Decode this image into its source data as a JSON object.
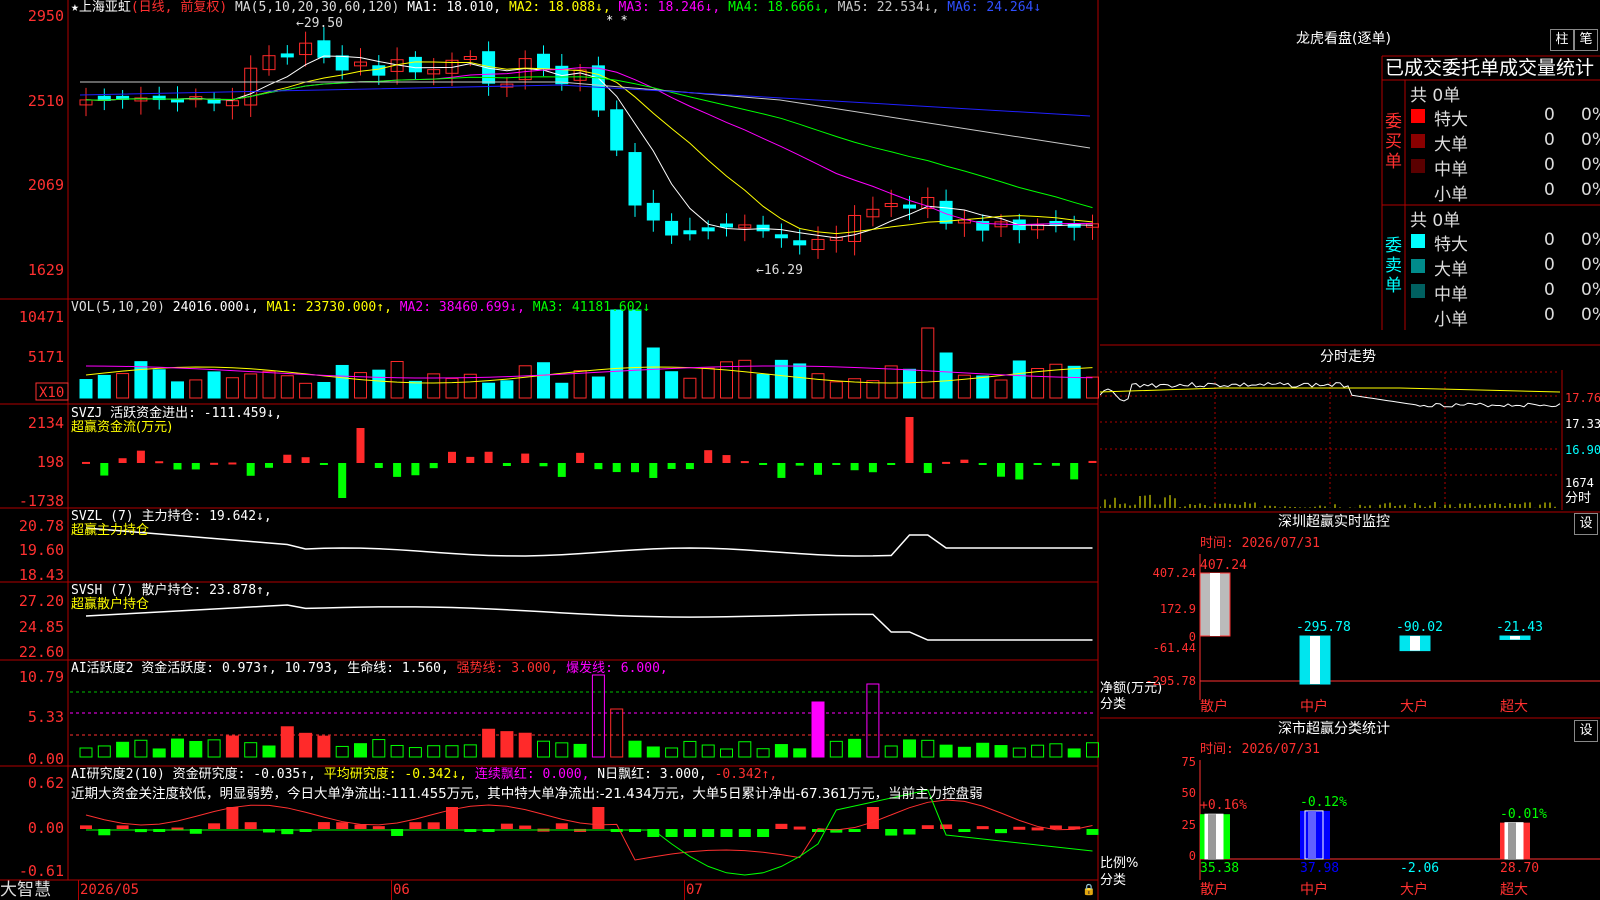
{
  "colors": {
    "up": "#ff2a2a",
    "down": "#00ffff",
    "ma1": "#ffffff",
    "ma2": "#ffff00",
    "ma3": "#ff00ff",
    "ma4": "#00ff00",
    "ma5": "#c8c8c8",
    "ma6": "#2020ff",
    "grid": "#b00000",
    "green": "#00ff00"
  },
  "kline": {
    "star": "★",
    "name": "上海亚虹",
    "period": "(日线, 前复权)",
    "ma_label": "MA(5,10,20,30,60,120)",
    "ma1": "MA1: 18.010,",
    "ma2": "MA2: 18.088↓,",
    "ma3": "MA3: 18.246↓,",
    "ma4": "MA4: 18.666↓,",
    "ma5": "MA5: 22.534↓,",
    "ma6": "MA6: 24.264↓",
    "axis": [
      "2950",
      "2510",
      "2069",
      "1629"
    ],
    "high_label": "←29.50",
    "low_label": "←16.29",
    "marks": "* *"
  },
  "vol": {
    "label": "VOL(5,10,20)",
    "v": "24016.000↓,",
    "ma1": "MA1: 23730.000↑,",
    "ma2": "MA2: 38460.699↓,",
    "ma3": "MA3: 41181.602↓",
    "axis": [
      "10471",
      "5171"
    ],
    "unit": "X10"
  },
  "svzj": {
    "label": "SVZJ  活跃资金进出: -111.459↓,",
    "sub": "超赢资金流(万元)",
    "axis": [
      "2134",
      "198",
      "-1738"
    ]
  },
  "svzl": {
    "label": "SVZL (7) 主力持仓: 19.642↓,",
    "sub": "超赢主力持仓",
    "axis": [
      "20.78",
      "19.60",
      "18.43"
    ]
  },
  "svsh": {
    "label": "SVSH (7) 散户持仓: 23.878↑,",
    "sub": "超赢散户持仓",
    "axis": [
      "27.20",
      "24.85",
      "22.60"
    ]
  },
  "ai1": {
    "a": "AI活跃度2 资金活跃度: 0.973↑,",
    "b": "10.793,",
    "c": "生命线: 1.560,",
    "d": "强势线: 3.000,",
    "e": "爆发线: 6.000,",
    "axis": [
      "10.79",
      "5.33",
      "0.00"
    ]
  },
  "ai2": {
    "a": "AI研究度2(10) 资金研究度: -0.035↑,",
    "b": "平均研究度: -0.342↓,",
    "c": "连续飘红: 0.000,",
    "d": "N日飘红: 3.000,",
    "e": "-0.342↑,",
    "desc": "近期大资金关注度较低，明显弱势，今日大单净流出:-111.455万元，其中特大单净流出:-21.434万元，大单5日累计净出-67.361万元，当前主力控盘弱",
    "axis": [
      "0.62",
      "0.00",
      "-0.61"
    ]
  },
  "bottom": {
    "brand": "大智慧",
    "dates": [
      "2026/05",
      "06",
      "07"
    ]
  },
  "lhb": {
    "title": "龙虎看盘(逐单)",
    "btn1": "柱",
    "btn2": "笔",
    "header": "已成交委托单成交量统计",
    "buy_side": "委\n买\n单",
    "sell_side": "委\n卖\n单",
    "buy_total": "共 0单",
    "sell_total": "共 0单",
    "buy": [
      {
        "label": "特大",
        "n": "0",
        "p": "0%",
        "c": "#ff0000"
      },
      {
        "label": "大单",
        "n": "0",
        "p": "0%",
        "c": "#8b0000"
      },
      {
        "label": "中单",
        "n": "0",
        "p": "0%",
        "c": "#5a0000"
      },
      {
        "label": "小单",
        "n": "0",
        "p": "0%",
        "c": "#000000"
      }
    ],
    "sell": [
      {
        "label": "特大",
        "n": "0",
        "p": "0%",
        "c": "#00ffff"
      },
      {
        "label": "大单",
        "n": "0",
        "p": "0%",
        "c": "#008b8b"
      },
      {
        "label": "中单",
        "n": "0",
        "p": "0%",
        "c": "#006060"
      },
      {
        "label": "小单",
        "n": "0",
        "p": "0%",
        "c": "#000000"
      }
    ]
  },
  "intraday": {
    "title": "分时走势",
    "axis": [
      "17.76",
      "17.33",
      "16.90",
      "1674"
    ],
    "unit": "分时"
  },
  "monitor": {
    "title": "深圳超赢实时监控",
    "btn": "设",
    "time": "时间: 2026/07/31",
    "axis": [
      "407.24",
      "172.9",
      "0",
      "-61.44",
      "-295.78"
    ],
    "ylabel": "净额(万元)",
    "xlabel": "分类",
    "bars": [
      {
        "cat": "散户",
        "v": 407.24,
        "label": "407.24"
      },
      {
        "cat": "中户",
        "v": -295.78,
        "label": "-295.78"
      },
      {
        "cat": "大户",
        "v": -90.02,
        "label": "-90.02"
      },
      {
        "cat": "超大",
        "v": -21.43,
        "label": "-21.43"
      }
    ]
  },
  "classify": {
    "title": "深市超赢分类统计",
    "btn": "设",
    "time": "时间: 2026/07/31",
    "axis": [
      "75",
      "50",
      "25",
      "0"
    ],
    "ylabel": "比例%",
    "xlabel": "分类",
    "bars": [
      {
        "cat": "散户",
        "v": 35.38,
        "pct": "+0.16%",
        "label": "35.38"
      },
      {
        "cat": "中户",
        "v": 37.98,
        "pct": "-0.12%",
        "label": "37.98"
      },
      {
        "cat": "大户",
        "v": -2.06,
        "pct": "",
        "label": "-2.06"
      },
      {
        "cat": "超大",
        "v": 28.7,
        "pct": "-0.01%",
        "label": "28.70"
      }
    ]
  }
}
